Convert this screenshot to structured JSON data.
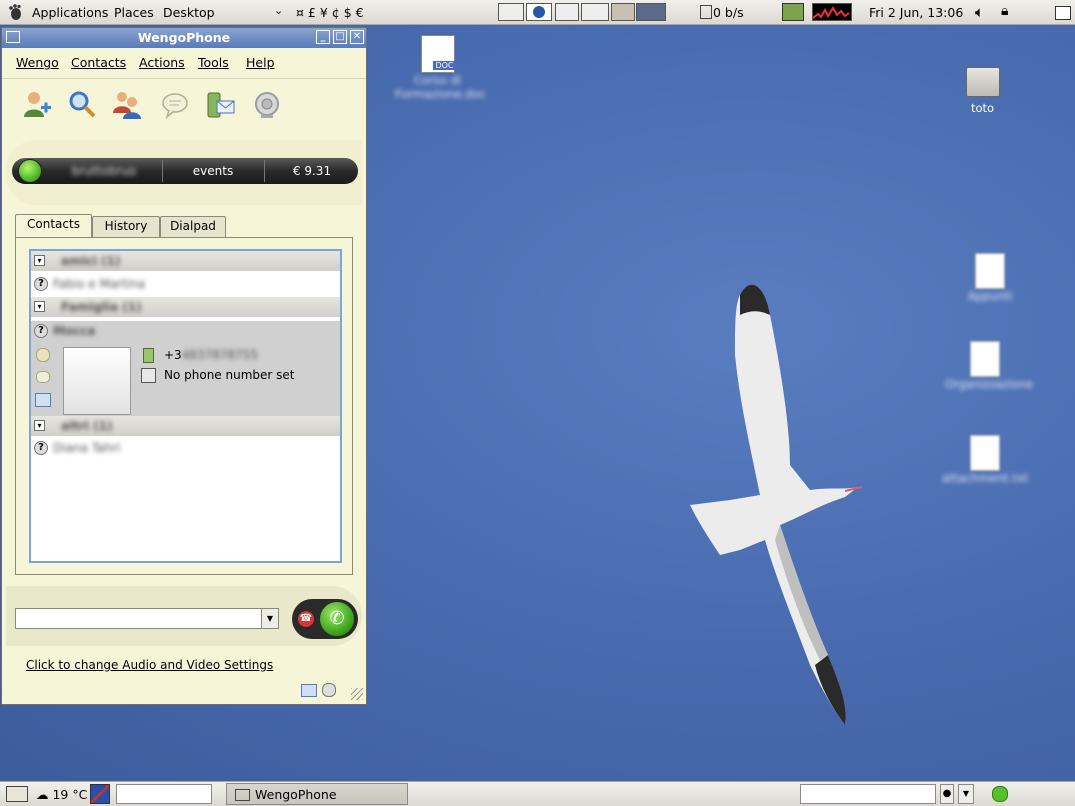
{
  "top_panel": {
    "menus": [
      "Applications",
      "Places",
      "Desktop"
    ],
    "currency_symbols": "¤  £  ¥  ¢  $  €",
    "net_speed": "0 b/s",
    "clock": "Fri  2 Jun, 13:06"
  },
  "window": {
    "title": "WengoPhone",
    "menu": [
      "Wengo",
      "Contacts",
      "Actions",
      "Tools",
      "Help"
    ],
    "toolbar_icons": [
      "add-contact-icon",
      "search-icon",
      "conference-icon",
      "chat-icon",
      "sms-icon",
      "webcam-icon"
    ],
    "status": {
      "username": "bruttobruo",
      "events_label": "events",
      "balance": "€ 9.31"
    },
    "tabs": [
      "Contacts",
      "History",
      "Dialpad"
    ],
    "groups": [
      {
        "name": "amici (1)",
        "contacts": [
          "Fabio e Martina"
        ]
      },
      {
        "name": "Famiglia (1)",
        "contacts": [
          "Mocca"
        ]
      },
      {
        "name": "altri (1)",
        "contacts": [
          "Diana Tahri"
        ]
      }
    ],
    "expanded_contact": {
      "mobile_prefix": "+3",
      "mobile_rest": "4837878755",
      "no_phone": "No phone number set"
    },
    "settings_link": "Click to change Audio and Video Settings"
  },
  "desktop_icons": [
    {
      "label": "Corso di Formazione.doc"
    },
    {
      "label": "toto"
    },
    {
      "label": "Appunti"
    },
    {
      "label": "Organizzazione"
    },
    {
      "label": "attachment.txt"
    }
  ],
  "bottom_panel": {
    "weather": "19 °C",
    "task": "WengoPhone"
  },
  "colors": {
    "desktop": "#4a6cb0",
    "window_bg": "#f6f5d8",
    "titlebar": "#6f8cc4",
    "status_green": "#58c02a"
  }
}
